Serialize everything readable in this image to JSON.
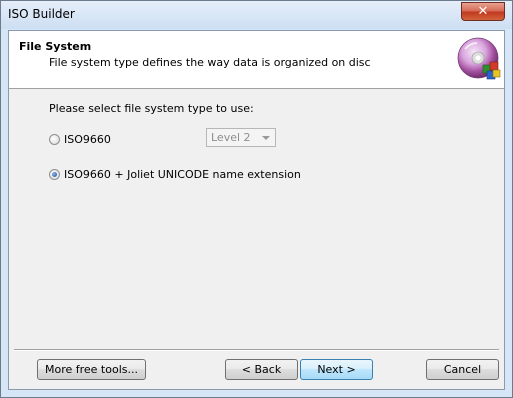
{
  "window": {
    "title": "ISO Builder",
    "close_glyph": "✕"
  },
  "header": {
    "title": "File System",
    "subtitle": "File system type defines the way data is organized on disc",
    "icon": "disc-icon"
  },
  "form": {
    "prompt": "Please select file system type to use:",
    "options": [
      {
        "label": "ISO9660",
        "checked": false
      },
      {
        "label": "ISO9660 + Joliet UNICODE name extension",
        "checked": true
      }
    ],
    "level_select": {
      "value": "Level 2",
      "enabled": false
    }
  },
  "buttons": {
    "more_tools": "More free tools...",
    "back": "< Back",
    "next": "Next >",
    "cancel": "Cancel"
  }
}
